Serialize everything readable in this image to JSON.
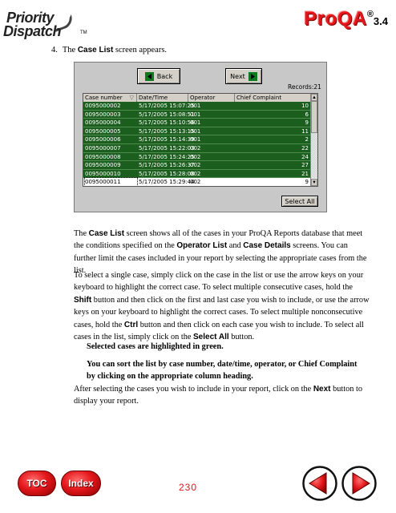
{
  "header": {
    "logo_line1": "Priority",
    "logo_line2": "Dispatch",
    "logo_tm": "TM",
    "brand_name": "ProQA",
    "brand_reg": "®",
    "brand_version": "3.4"
  },
  "step": {
    "number": "4.",
    "text_pre": "The ",
    "text_bold": "Case List",
    "text_post": " screen appears."
  },
  "screenshot": {
    "back_label": "Back",
    "next_label": "Next",
    "records_label": "Records:21",
    "columns": [
      "Case number",
      "Date/Time",
      "Operator",
      "Chief Complaint"
    ],
    "rows": [
      [
        "0095000002",
        "5/17/2005 15:07:25",
        "001",
        "10"
      ],
      [
        "0095000003",
        "5/17/2005 15:08:51",
        "001",
        "6"
      ],
      [
        "0095000004",
        "5/17/2005 15:10:56",
        "001",
        "9"
      ],
      [
        "0095000005",
        "5/17/2005 15:13:15",
        "001",
        "11"
      ],
      [
        "0095000006",
        "5/17/2005 15:14:39",
        "001",
        "2"
      ],
      [
        "0095000007",
        "5/17/2005 15:22:03",
        "002",
        "22"
      ],
      [
        "0095000008",
        "5/17/2005 15:24:25",
        "002",
        "24"
      ],
      [
        "0095000009",
        "5/17/2005 15:26:37",
        "002",
        "27"
      ],
      [
        "0095000010",
        "5/17/2005 15:28:08",
        "002",
        "21"
      ],
      [
        "0095000011",
        "5/17/2005 15:29:44",
        "002",
        "9"
      ]
    ],
    "select_all_label": "Select All"
  },
  "body": {
    "p1_a": "The ",
    "p1_b": "Case List",
    "p1_c": " screen shows all of the cases in your ProQA Reports database that meet the conditions specified on the ",
    "p1_d": "Operator List",
    "p1_e": " and ",
    "p1_f": "Case Details",
    "p1_g": " screens. You can further limit the cases included in your report by selecting the appropriate cases from the list.",
    "p2_a": "To select a single case, simply click on the case in the list or use the arrow keys on your keyboard to highlight the correct case. To select multiple consecutive cases, hold the ",
    "p2_b": "Shift",
    "p2_c": " button and then click on the first and last case you wish to include, or use the arrow keys on your keyboard to highlight the correct cases. To select multiple nonconsecutive cases, hold the ",
    "p2_d": "Ctrl",
    "p2_e": " button and then click on each case you wish to include. To select all cases in the list, simply click on the ",
    "p2_f": "Select All",
    "p2_g": " button.",
    "note1": "Selected cases are highlighted in green.",
    "note2": "You can sort the list by case number, date/time, operator, or Chief Complaint by clicking on the appropriate column heading.",
    "p3_a": "After selecting the cases you wish to include in your report, click on the ",
    "p3_b": "Next",
    "p3_c": " button to display your report."
  },
  "footer": {
    "toc_label": "TOC",
    "index_label": "Index",
    "page_number": "230"
  }
}
